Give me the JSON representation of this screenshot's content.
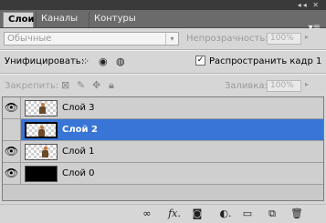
{
  "tabs": [
    "Слои",
    "Каналы",
    "Контуры"
  ],
  "panel_menu_icon": "panel-menu-icon",
  "blend_mode": {
    "value": "Обычные"
  },
  "opacity": {
    "label": "Непрозрачность:",
    "value": "100%"
  },
  "unify": {
    "label": "Унифицировать:",
    "icons": [
      "unify-position-icon",
      "unify-visibility-icon",
      "unify-style-icon"
    ],
    "propagate_checked": true,
    "propagate_label": "Распространить кадр 1"
  },
  "lock": {
    "label": "Закрепить:",
    "icons": [
      "lock-transparency-icon",
      "lock-paint-icon",
      "lock-move-icon",
      "lock-all-icon"
    ]
  },
  "fill": {
    "label": "Заливка:",
    "value": "100%"
  },
  "layers": [
    {
      "name": "Слой 3",
      "visible": true,
      "selected": false,
      "thumb": "figure"
    },
    {
      "name": "Слой 2",
      "visible": false,
      "selected": true,
      "thumb": "figure"
    },
    {
      "name": "Слой 1",
      "visible": true,
      "selected": false,
      "thumb": "figure"
    },
    {
      "name": "Слой 0",
      "visible": true,
      "selected": false,
      "thumb": "black"
    }
  ],
  "bottom_icons": [
    "link-icon",
    "fx-icon",
    "mask-icon",
    "adjustment-icon",
    "group-folder-icon",
    "new-layer-icon",
    "trash-icon"
  ],
  "colors": {
    "selection": "#3875d7",
    "panel": "#d6d6d6",
    "tabstrip": "#6b6b6b"
  }
}
